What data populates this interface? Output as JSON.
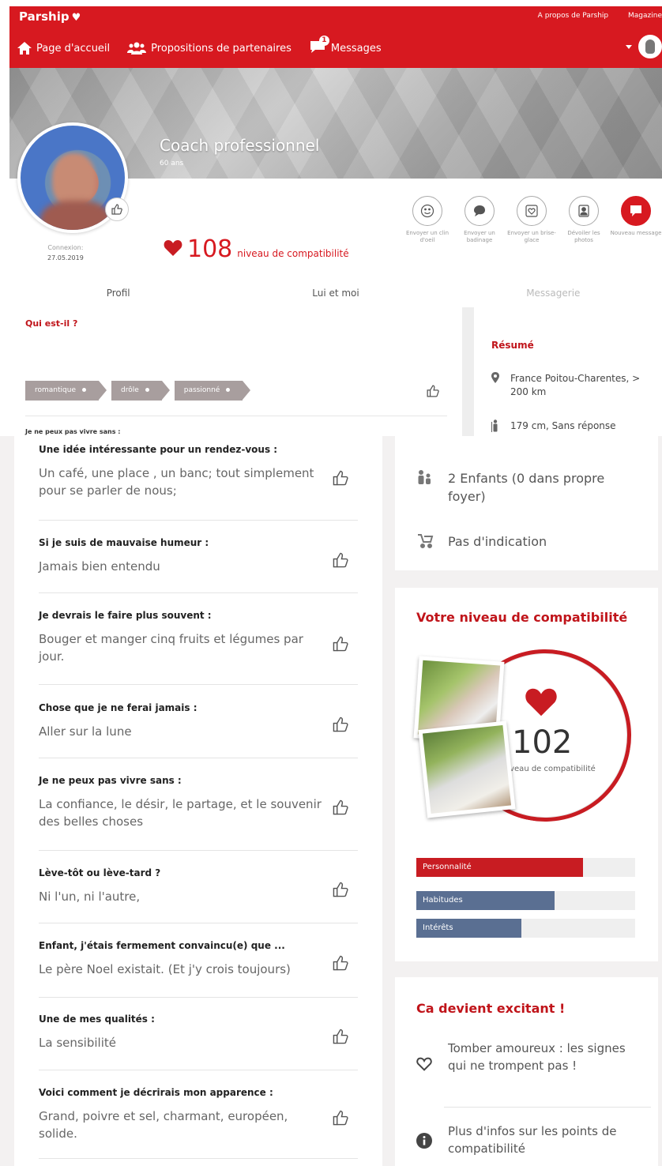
{
  "header": {
    "brand": "Parship",
    "top_links": [
      "A propos de Parship",
      "Magazine"
    ],
    "nav": [
      {
        "label": "Page d'accueil"
      },
      {
        "label": "Propositions de partenaires"
      },
      {
        "label": "Messages",
        "badge": "1"
      }
    ]
  },
  "profile": {
    "name": "Coach professionnel",
    "age": "60 ans",
    "connexion_label": "Connexion:",
    "connexion_date": "27.05.2019",
    "compat_number": "108",
    "compat_label": "niveau de compatibilité"
  },
  "actions": [
    {
      "label": "Envoyer un clin d'oeil"
    },
    {
      "label": "Envoyer un badinage"
    },
    {
      "label": "Envoyer un brise-glace"
    },
    {
      "label": "Dévoiler les photos"
    },
    {
      "label": "Nouveau message"
    }
  ],
  "tabs": [
    "Profil",
    "Lui et moi",
    "Messagerie"
  ],
  "who": {
    "title": "Qui est-il ?",
    "tags": [
      "romantique",
      "drôle",
      "passionné"
    ],
    "partial_question": "Je ne peux pas vivre sans :"
  },
  "summary": {
    "title": "Résumé",
    "location": "France Poitou-Charentes, > 200 km",
    "height": "179 cm, Sans réponse",
    "children": "2 Enfants (0 dans propre foyer)",
    "wish_children": "Pas d'indication"
  },
  "qa": [
    {
      "q": "Une idée intéressante pour un rendez-vous :",
      "a": "Un café, une place , un banc; tout simplement pour se parler de nous;"
    },
    {
      "q": "Si je suis de mauvaise humeur :",
      "a": "Jamais bien entendu"
    },
    {
      "q": "Je devrais le faire plus souvent :",
      "a": "Bouger et manger cinq fruits et légumes par jour."
    },
    {
      "q": "Chose que je ne ferai jamais :",
      "a": "Aller sur la lune"
    },
    {
      "q": "Je ne peux pas vivre sans :",
      "a": "La confiance, le désir, le partage, et le souvenir des belles choses"
    },
    {
      "q": "Lève-tôt ou lève-tard ?",
      "a": "Ni l'un, ni l'autre,"
    },
    {
      "q": "Enfant, j'étais fermement convaincu(e) que ...",
      "a": "Le père Noel existait. (Et j'y crois toujours)"
    },
    {
      "q": "Une de mes qualités :",
      "a": "La sensibilité"
    },
    {
      "q": "Voici comment je décrirais mon apparence :",
      "a": "Grand, poivre et sel, charmant, européen, solide."
    }
  ],
  "compat": {
    "title": "Votre niveau de compatibilité",
    "number": "102",
    "label": "niveau de compatibilité",
    "bars": [
      {
        "label": "Personnalité",
        "value": 0.76,
        "color": "#c81c22"
      },
      {
        "label": "Habitudes",
        "value": 0.63,
        "color": "#5a6f92"
      },
      {
        "label": "Intérêts",
        "value": 0.48,
        "color": "#5a6f92"
      }
    ]
  },
  "exciting": {
    "title": "Ca devient excitant !",
    "items": [
      {
        "label": "Tomber amoureux : les signes qui ne trompent pas !"
      },
      {
        "label": "Plus d'infos sur les points de compatibilité"
      }
    ]
  }
}
